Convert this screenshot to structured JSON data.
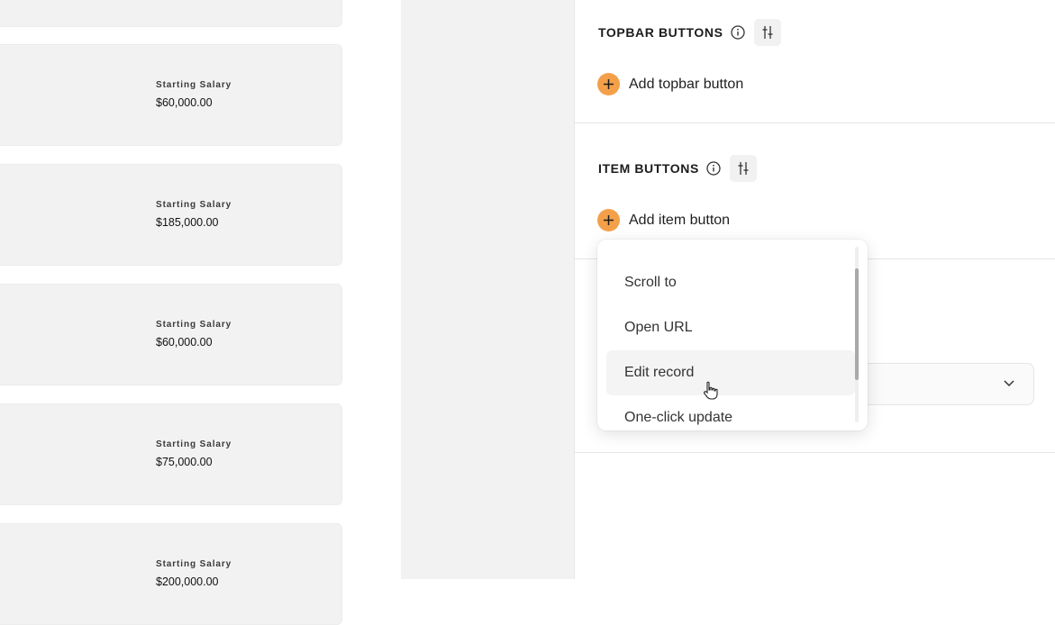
{
  "preview": {
    "cards": [
      {
        "label": "Starting Salary",
        "value": "$60,000.00"
      },
      {
        "label": "Starting Salary",
        "value": "$185,000.00"
      },
      {
        "label": "Starting Salary",
        "value": "$60,000.00"
      },
      {
        "label": "Starting Salary",
        "value": "$75,000.00"
      },
      {
        "label": "Starting Salary",
        "value": "$200,000.00"
      }
    ]
  },
  "panel": {
    "topbar": {
      "title": "TOPBAR BUTTONS",
      "add_label": "Add topbar button"
    },
    "item": {
      "title": "ITEM BUTTONS",
      "add_label": "Add item button"
    }
  },
  "menu": {
    "items": [
      "Scroll to",
      "Open URL",
      "Edit record",
      "One-click update"
    ],
    "hovered": "Edit record"
  },
  "colors": {
    "accent": "#f4a04a",
    "card_bg": "#f2f2f2",
    "mid_bg": "#f2f2f2"
  }
}
